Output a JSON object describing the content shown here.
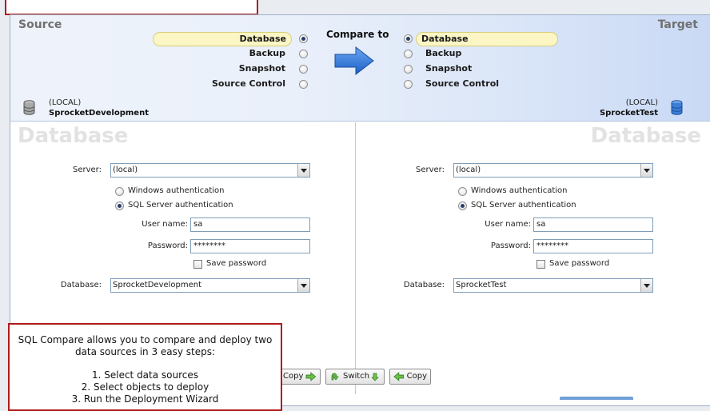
{
  "header": {
    "source_title": "Source",
    "target_title": "Target",
    "compare_to": "Compare to",
    "source_options": [
      {
        "label": "Database",
        "selected": true
      },
      {
        "label": "Backup",
        "selected": false
      },
      {
        "label": "Snapshot",
        "selected": false
      },
      {
        "label": "Source Control",
        "selected": false
      }
    ],
    "target_options": [
      {
        "label": "Database",
        "selected": true
      },
      {
        "label": "Backup",
        "selected": false
      },
      {
        "label": "Snapshot",
        "selected": false
      },
      {
        "label": "Source Control",
        "selected": false
      }
    ],
    "source_server_local": "(LOCAL)",
    "source_server_name": "SprocketDevelopment",
    "target_server_local": "(LOCAL)",
    "target_server_name": "SprocketTest"
  },
  "source_panel": {
    "watermark": "Database",
    "server_label": "Server:",
    "server_value": "(local)",
    "auth_windows": "Windows authentication",
    "auth_sql": "SQL Server authentication",
    "auth_selected": "sql",
    "username_label": "User name:",
    "username_value": "sa",
    "password_label": "Password:",
    "password_value": "********",
    "save_password": "Save password",
    "database_label": "Database:",
    "database_value": "SprocketDevelopment"
  },
  "target_panel": {
    "watermark": "Database",
    "server_label": "Server:",
    "server_value": "(local)",
    "auth_windows": "Windows authentication",
    "auth_sql": "SQL Server authentication",
    "auth_selected": "sql",
    "username_label": "User name:",
    "username_value": "sa",
    "password_label": "Password:",
    "password_value": "********",
    "save_password": "Save password",
    "database_label": "Database:",
    "database_value": "SprocketTest"
  },
  "buttons": {
    "copy_right": "Copy",
    "switch": "Switch",
    "copy_left": "Copy"
  },
  "callout": {
    "line1": "SQL Compare allows you to compare and deploy two",
    "line2": "data sources in 3 easy steps:",
    "step1": "1. Select data sources",
    "step2": "2. Select objects to deploy",
    "step3": "3. Run the Deployment Wizard"
  },
  "colors": {
    "callout_border": "#b01c1c",
    "arrow_blue": "#1e6ed6",
    "selected_highlight": "#fbf6c4"
  }
}
